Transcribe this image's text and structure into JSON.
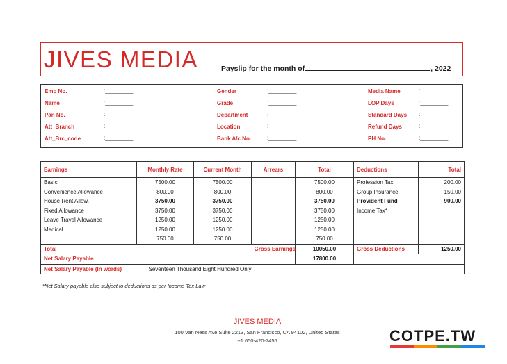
{
  "header": {
    "brand": "JIVES MEDIA",
    "payslip_label": "Payslip for the month of",
    "year": ", 2022"
  },
  "info": {
    "left": [
      {
        "label": "Emp No.",
        "value": ":_________"
      },
      {
        "label": "Name",
        "value": ":_________"
      },
      {
        "label": "Pan No.",
        "value": ":_________"
      },
      {
        "label": "Att_Branch",
        "value": ":_________"
      },
      {
        "label": "Att_Brc_code",
        "value": ":_________"
      }
    ],
    "middle": [
      {
        "label": "Gender",
        "value": ":_________"
      },
      {
        "label": "Grade",
        "value": ":_________"
      },
      {
        "label": "Department",
        "value": ":_________"
      },
      {
        "label": "Location",
        "value": ":_________"
      },
      {
        "label": "Bank A/c No.",
        "value": ":_________"
      }
    ],
    "right": [
      {
        "label": "Media Name",
        "value": ":"
      },
      {
        "label": "LOP Days",
        "value": ":_________"
      },
      {
        "label": "Standard Days",
        "value": ":_________"
      },
      {
        "label": "Refund Days",
        "value": ":_________"
      },
      {
        "label": "PH No.",
        "value": ":_________"
      }
    ]
  },
  "table": {
    "headers": {
      "earnings": "Earnings",
      "monthly_rate": "Monthly Rate",
      "current_month": "Current Month",
      "arrears": "Arrears",
      "total": "Total",
      "deductions": "Deductions",
      "ded_total": "Total"
    },
    "rows": [
      {
        "earning": "Basic",
        "monthly": "7500.00",
        "current": "7500.00",
        "arrears": "",
        "total": "7500.00",
        "deduction": "Profession Tax",
        "ded_total": "200.00"
      },
      {
        "earning": "Convenience Allowance",
        "monthly": "800.00",
        "current": "800.00",
        "arrears": "",
        "total": "800.00",
        "deduction": "Group Insurance",
        "ded_total": "150.00"
      },
      {
        "earning": "House Rent Allow.",
        "monthly": "3750.00",
        "current": "3750.00",
        "arrears": "",
        "total": "3750.00",
        "deduction": "Provident Fund",
        "ded_total": "900.00"
      },
      {
        "earning": "Fixed Allowance",
        "monthly": "3750.00",
        "current": "3750.00",
        "arrears": "",
        "total": "3750.00",
        "deduction": "Income Tax*",
        "ded_total": ""
      },
      {
        "earning": "Leave Travel Allowance",
        "monthly": "1250.00",
        "current": "1250.00",
        "arrears": "",
        "total": "1250.00",
        "deduction": "",
        "ded_total": ""
      },
      {
        "earning": "Medical",
        "monthly": "1250.00",
        "current": "1250.00",
        "arrears": "",
        "total": "1250.00",
        "deduction": "",
        "ded_total": ""
      },
      {
        "earning": "",
        "monthly": "750.00",
        "current": "750.00",
        "arrears": "",
        "total": "750.00",
        "deduction": "",
        "ded_total": ""
      }
    ],
    "total_row": {
      "label": "Total",
      "gross_earnings_label": "Gross Earnings",
      "gross_earnings": "10050.00",
      "gross_deductions_label": "Gross Deductions",
      "gross_deductions": "1250.00"
    },
    "net_salary": {
      "label": "Net Salary Payable",
      "value": "17800.00"
    },
    "net_words": {
      "label": "Net Salary Payable (In words)",
      "value": "Seventeen Thousand Eight Hundred Only"
    }
  },
  "note": "*Net Salary payable also subject to deductions as per Income Tax Law",
  "footer": {
    "company": "JIVES MEDIA",
    "address": "100 Van Ness Ave Suite 2213, San Francisco, CA 94102, United States",
    "phone": "+1 650-420-7455"
  },
  "watermark": {
    "text": "COTPE.TW",
    "bar_colors": [
      "#e53935",
      "#fb8c00",
      "#43a047",
      "#1e88e5"
    ]
  }
}
